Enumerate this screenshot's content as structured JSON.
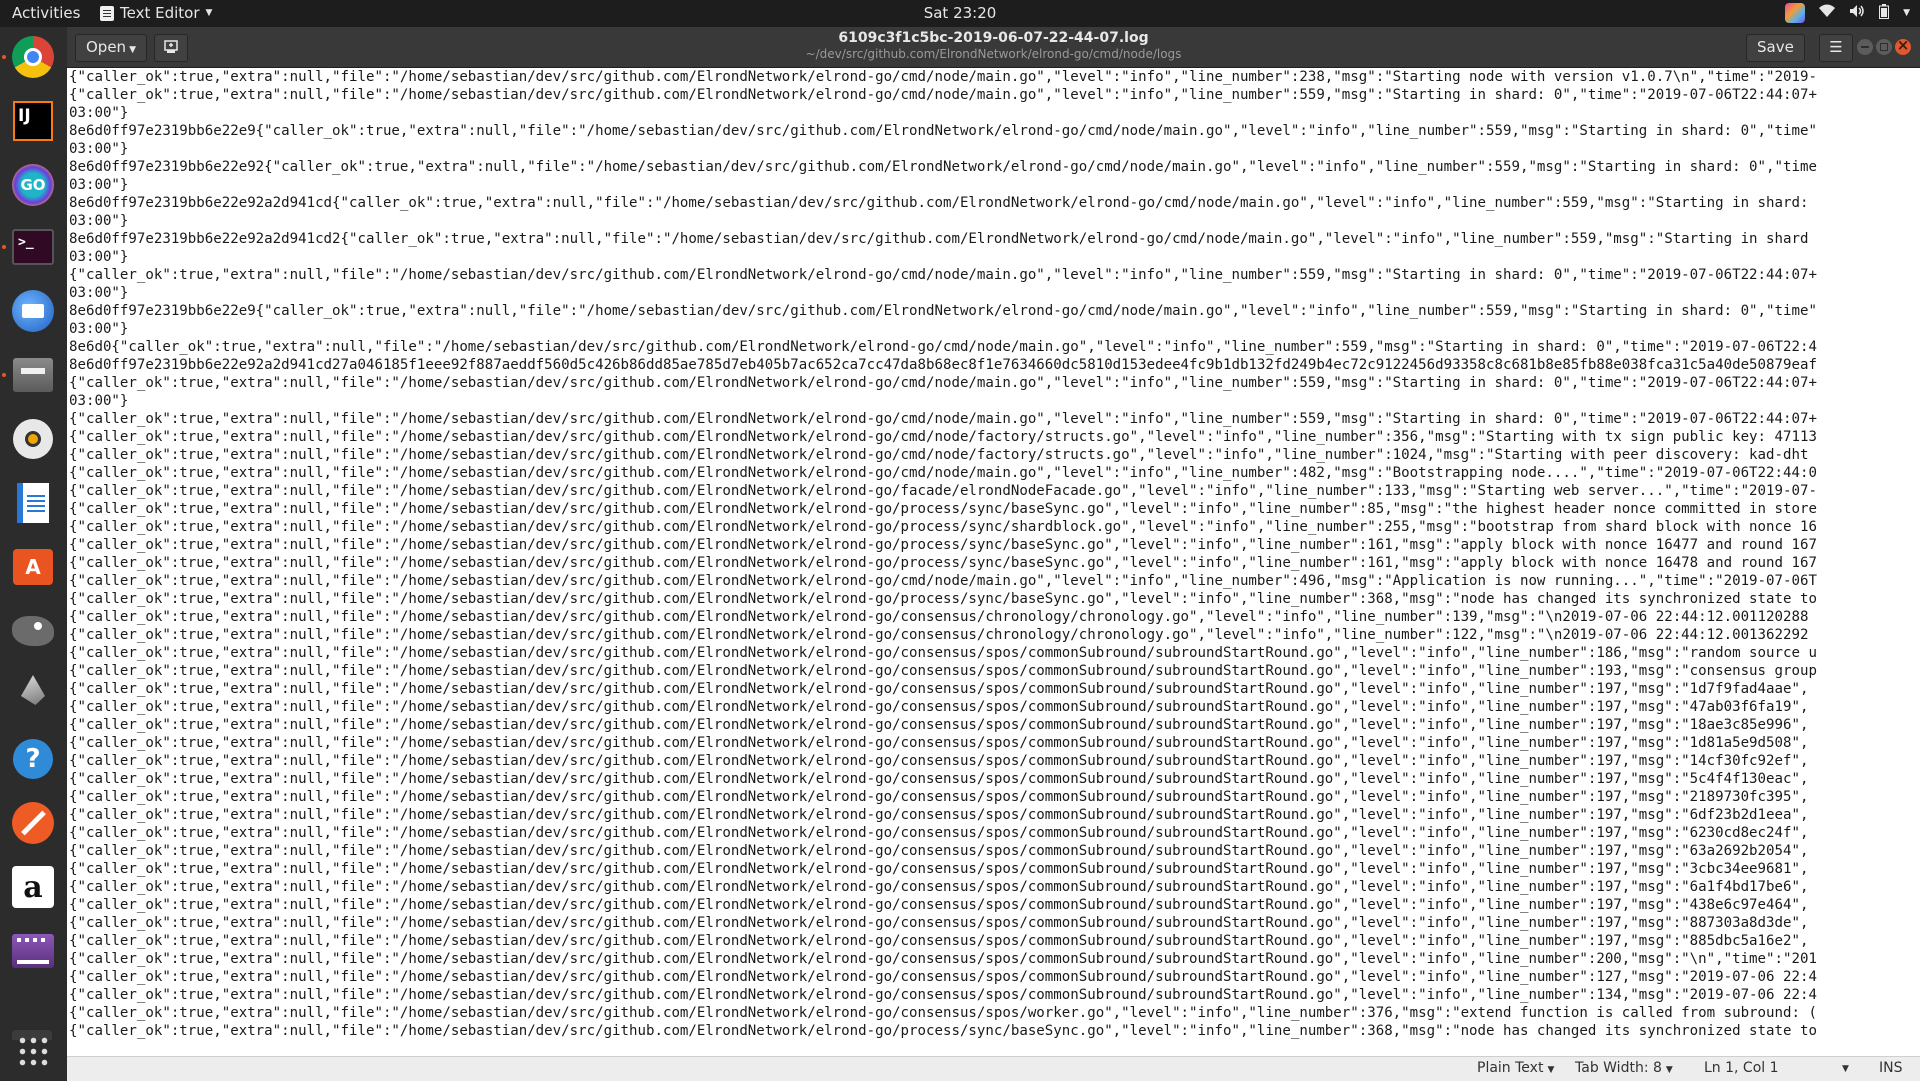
{
  "topbar": {
    "activities": "Activities",
    "app_name": "Text Editor",
    "clock": "Sat 23:20"
  },
  "dock": {
    "items": [
      "Chrome",
      "IntelliJ IDEA",
      "GoLand",
      "Terminal",
      "Thunderbird",
      "Files",
      "Rhythmbox",
      "LibreOffice Writer",
      "Ubuntu Software",
      "GIMP",
      "Inkscape",
      "Help",
      "Postman",
      "Amazon",
      "Videos",
      "Show Applications"
    ]
  },
  "header": {
    "open_label": "Open",
    "title": "6109c3f1c5bc-2019-06-07-22-44-07.log",
    "path": "~/dev/src/github.com/ElrondNetwork/elrond-go/cmd/node/logs",
    "save_label": "Save"
  },
  "editor": {
    "lines": [
      "{\"caller_ok\":true,\"extra\":null,\"file\":\"/home/sebastian/dev/src/github.com/ElrondNetwork/elrond-go/cmd/node/main.go\",\"level\":\"info\",\"line_number\":238,\"msg\":\"Starting node with version v1.0.7\\n\",\"time\":\"2019-",
      "{\"caller_ok\":true,\"extra\":null,\"file\":\"/home/sebastian/dev/src/github.com/ElrondNetwork/elrond-go/cmd/node/main.go\",\"level\":\"info\",\"line_number\":559,\"msg\":\"Starting in shard: 0\",\"time\":\"2019-07-06T22:44:07+",
      "03:00\"}",
      "8e6d0ff97e2319bb6e22e9{\"caller_ok\":true,\"extra\":null,\"file\":\"/home/sebastian/dev/src/github.com/ElrondNetwork/elrond-go/cmd/node/main.go\",\"level\":\"info\",\"line_number\":559,\"msg\":\"Starting in shard: 0\",\"time\"",
      "03:00\"}",
      "8e6d0ff97e2319bb6e22e92{\"caller_ok\":true,\"extra\":null,\"file\":\"/home/sebastian/dev/src/github.com/ElrondNetwork/elrond-go/cmd/node/main.go\",\"level\":\"info\",\"line_number\":559,\"msg\":\"Starting in shard: 0\",\"time",
      "03:00\"}",
      "8e6d0ff97e2319bb6e22e92a2d941cd{\"caller_ok\":true,\"extra\":null,\"file\":\"/home/sebastian/dev/src/github.com/ElrondNetwork/elrond-go/cmd/node/main.go\",\"level\":\"info\",\"line_number\":559,\"msg\":\"Starting in shard:",
      "03:00\"}",
      "8e6d0ff97e2319bb6e22e92a2d941cd2{\"caller_ok\":true,\"extra\":null,\"file\":\"/home/sebastian/dev/src/github.com/ElrondNetwork/elrond-go/cmd/node/main.go\",\"level\":\"info\",\"line_number\":559,\"msg\":\"Starting in shard",
      "03:00\"}",
      "{\"caller_ok\":true,\"extra\":null,\"file\":\"/home/sebastian/dev/src/github.com/ElrondNetwork/elrond-go/cmd/node/main.go\",\"level\":\"info\",\"line_number\":559,\"msg\":\"Starting in shard: 0\",\"time\":\"2019-07-06T22:44:07+",
      "03:00\"}",
      "8e6d0ff97e2319bb6e22e9{\"caller_ok\":true,\"extra\":null,\"file\":\"/home/sebastian/dev/src/github.com/ElrondNetwork/elrond-go/cmd/node/main.go\",\"level\":\"info\",\"line_number\":559,\"msg\":\"Starting in shard: 0\",\"time\"",
      "03:00\"}",
      "8e6d0{\"caller_ok\":true,\"extra\":null,\"file\":\"/home/sebastian/dev/src/github.com/ElrondNetwork/elrond-go/cmd/node/main.go\",\"level\":\"info\",\"line_number\":559,\"msg\":\"Starting in shard: 0\",\"time\":\"2019-07-06T22:4",
      "8e6d0ff97e2319bb6e22e92a2d941cd27a046185f1eee92f887aeddf560d5c426b86dd85ae785d7eb405b7ac652ca7cc47da8b68ec8f1e7634660dc5810d153edee4fc9b1db132fd249b4ec72c9122456d93358c8c681b8e85fb88e038fca31c5a40de50879eaf",
      "{\"caller_ok\":true,\"extra\":null,\"file\":\"/home/sebastian/dev/src/github.com/ElrondNetwork/elrond-go/cmd/node/main.go\",\"level\":\"info\",\"line_number\":559,\"msg\":\"Starting in shard: 0\",\"time\":\"2019-07-06T22:44:07+",
      "03:00\"}",
      "{\"caller_ok\":true,\"extra\":null,\"file\":\"/home/sebastian/dev/src/github.com/ElrondNetwork/elrond-go/cmd/node/main.go\",\"level\":\"info\",\"line_number\":559,\"msg\":\"Starting in shard: 0\",\"time\":\"2019-07-06T22:44:07+",
      "{\"caller_ok\":true,\"extra\":null,\"file\":\"/home/sebastian/dev/src/github.com/ElrondNetwork/elrond-go/cmd/node/factory/structs.go\",\"level\":\"info\",\"line_number\":356,\"msg\":\"Starting with tx sign public key: 47113",
      "{\"caller_ok\":true,\"extra\":null,\"file\":\"/home/sebastian/dev/src/github.com/ElrondNetwork/elrond-go/cmd/node/factory/structs.go\",\"level\":\"info\",\"line_number\":1024,\"msg\":\"Starting with peer discovery: kad-dht",
      "{\"caller_ok\":true,\"extra\":null,\"file\":\"/home/sebastian/dev/src/github.com/ElrondNetwork/elrond-go/cmd/node/main.go\",\"level\":\"info\",\"line_number\":482,\"msg\":\"Bootstrapping node....\",\"time\":\"2019-07-06T22:44:0",
      "{\"caller_ok\":true,\"extra\":null,\"file\":\"/home/sebastian/dev/src/github.com/ElrondNetwork/elrond-go/facade/elrondNodeFacade.go\",\"level\":\"info\",\"line_number\":133,\"msg\":\"Starting web server...\",\"time\":\"2019-07-",
      "{\"caller_ok\":true,\"extra\":null,\"file\":\"/home/sebastian/dev/src/github.com/ElrondNetwork/elrond-go/process/sync/baseSync.go\",\"level\":\"info\",\"line_number\":85,\"msg\":\"the highest header nonce committed in store",
      "{\"caller_ok\":true,\"extra\":null,\"file\":\"/home/sebastian/dev/src/github.com/ElrondNetwork/elrond-go/process/sync/shardblock.go\",\"level\":\"info\",\"line_number\":255,\"msg\":\"bootstrap from shard block with nonce 16",
      "{\"caller_ok\":true,\"extra\":null,\"file\":\"/home/sebastian/dev/src/github.com/ElrondNetwork/elrond-go/process/sync/baseSync.go\",\"level\":\"info\",\"line_number\":161,\"msg\":\"apply block with nonce 16477 and round 167",
      "{\"caller_ok\":true,\"extra\":null,\"file\":\"/home/sebastian/dev/src/github.com/ElrondNetwork/elrond-go/process/sync/baseSync.go\",\"level\":\"info\",\"line_number\":161,\"msg\":\"apply block with nonce 16478 and round 167",
      "{\"caller_ok\":true,\"extra\":null,\"file\":\"/home/sebastian/dev/src/github.com/ElrondNetwork/elrond-go/cmd/node/main.go\",\"level\":\"info\",\"line_number\":496,\"msg\":\"Application is now running...\",\"time\":\"2019-07-06T",
      "{\"caller_ok\":true,\"extra\":null,\"file\":\"/home/sebastian/dev/src/github.com/ElrondNetwork/elrond-go/process/sync/baseSync.go\",\"level\":\"info\",\"line_number\":368,\"msg\":\"node has changed its synchronized state to",
      "{\"caller_ok\":true,\"extra\":null,\"file\":\"/home/sebastian/dev/src/github.com/ElrondNetwork/elrond-go/consensus/chronology/chronology.go\",\"level\":\"info\",\"line_number\":139,\"msg\":\"\\n2019-07-06 22:44:12.001120288 ",
      "{\"caller_ok\":true,\"extra\":null,\"file\":\"/home/sebastian/dev/src/github.com/ElrondNetwork/elrond-go/consensus/chronology/chronology.go\",\"level\":\"info\",\"line_number\":122,\"msg\":\"\\n2019-07-06 22:44:12.001362292 ",
      "{\"caller_ok\":true,\"extra\":null,\"file\":\"/home/sebastian/dev/src/github.com/ElrondNetwork/elrond-go/consensus/spos/commonSubround/subroundStartRound.go\",\"level\":\"info\",\"line_number\":186,\"msg\":\"random source u",
      "{\"caller_ok\":true,\"extra\":null,\"file\":\"/home/sebastian/dev/src/github.com/ElrondNetwork/elrond-go/consensus/spos/commonSubround/subroundStartRound.go\",\"level\":\"info\",\"line_number\":193,\"msg\":\"consensus group",
      "{\"caller_ok\":true,\"extra\":null,\"file\":\"/home/sebastian/dev/src/github.com/ElrondNetwork/elrond-go/consensus/spos/commonSubround/subroundStartRound.go\",\"level\":\"info\",\"line_number\":197,\"msg\":\"1d7f9fad4aae\",",
      "{\"caller_ok\":true,\"extra\":null,\"file\":\"/home/sebastian/dev/src/github.com/ElrondNetwork/elrond-go/consensus/spos/commonSubround/subroundStartRound.go\",\"level\":\"info\",\"line_number\":197,\"msg\":\"47ab03f6fa19\",",
      "{\"caller_ok\":true,\"extra\":null,\"file\":\"/home/sebastian/dev/src/github.com/ElrondNetwork/elrond-go/consensus/spos/commonSubround/subroundStartRound.go\",\"level\":\"info\",\"line_number\":197,\"msg\":\"18ae3c85e996\",",
      "{\"caller_ok\":true,\"extra\":null,\"file\":\"/home/sebastian/dev/src/github.com/ElrondNetwork/elrond-go/consensus/spos/commonSubround/subroundStartRound.go\",\"level\":\"info\",\"line_number\":197,\"msg\":\"1d81a5e9d508\",",
      "{\"caller_ok\":true,\"extra\":null,\"file\":\"/home/sebastian/dev/src/github.com/ElrondNetwork/elrond-go/consensus/spos/commonSubround/subroundStartRound.go\",\"level\":\"info\",\"line_number\":197,\"msg\":\"14cf30fc92ef\",",
      "{\"caller_ok\":true,\"extra\":null,\"file\":\"/home/sebastian/dev/src/github.com/ElrondNetwork/elrond-go/consensus/spos/commonSubround/subroundStartRound.go\",\"level\":\"info\",\"line_number\":197,\"msg\":\"5c4f4f130eac\",",
      "{\"caller_ok\":true,\"extra\":null,\"file\":\"/home/sebastian/dev/src/github.com/ElrondNetwork/elrond-go/consensus/spos/commonSubround/subroundStartRound.go\",\"level\":\"info\",\"line_number\":197,\"msg\":\"2189730fc395\",",
      "{\"caller_ok\":true,\"extra\":null,\"file\":\"/home/sebastian/dev/src/github.com/ElrondNetwork/elrond-go/consensus/spos/commonSubround/subroundStartRound.go\",\"level\":\"info\",\"line_number\":197,\"msg\":\"6df23b2d1eea\",",
      "{\"caller_ok\":true,\"extra\":null,\"file\":\"/home/sebastian/dev/src/github.com/ElrondNetwork/elrond-go/consensus/spos/commonSubround/subroundStartRound.go\",\"level\":\"info\",\"line_number\":197,\"msg\":\"6230cd8ec24f\",",
      "{\"caller_ok\":true,\"extra\":null,\"file\":\"/home/sebastian/dev/src/github.com/ElrondNetwork/elrond-go/consensus/spos/commonSubround/subroundStartRound.go\",\"level\":\"info\",\"line_number\":197,\"msg\":\"63a2692b2054\",",
      "{\"caller_ok\":true,\"extra\":null,\"file\":\"/home/sebastian/dev/src/github.com/ElrondNetwork/elrond-go/consensus/spos/commonSubround/subroundStartRound.go\",\"level\":\"info\",\"line_number\":197,\"msg\":\"3cbc34ee9681\",",
      "{\"caller_ok\":true,\"extra\":null,\"file\":\"/home/sebastian/dev/src/github.com/ElrondNetwork/elrond-go/consensus/spos/commonSubround/subroundStartRound.go\",\"level\":\"info\",\"line_number\":197,\"msg\":\"6a1f4bd17be6\",",
      "{\"caller_ok\":true,\"extra\":null,\"file\":\"/home/sebastian/dev/src/github.com/ElrondNetwork/elrond-go/consensus/spos/commonSubround/subroundStartRound.go\",\"level\":\"info\",\"line_number\":197,\"msg\":\"438e6c97e464\",",
      "{\"caller_ok\":true,\"extra\":null,\"file\":\"/home/sebastian/dev/src/github.com/ElrondNetwork/elrond-go/consensus/spos/commonSubround/subroundStartRound.go\",\"level\":\"info\",\"line_number\":197,\"msg\":\"887303a8d3de\",",
      "{\"caller_ok\":true,\"extra\":null,\"file\":\"/home/sebastian/dev/src/github.com/ElrondNetwork/elrond-go/consensus/spos/commonSubround/subroundStartRound.go\",\"level\":\"info\",\"line_number\":197,\"msg\":\"885dbc5a16e2\",",
      "{\"caller_ok\":true,\"extra\":null,\"file\":\"/home/sebastian/dev/src/github.com/ElrondNetwork/elrond-go/consensus/spos/commonSubround/subroundStartRound.go\",\"level\":\"info\",\"line_number\":200,\"msg\":\"\\n\",\"time\":\"201",
      "{\"caller_ok\":true,\"extra\":null,\"file\":\"/home/sebastian/dev/src/github.com/ElrondNetwork/elrond-go/consensus/spos/commonSubround/subroundStartRound.go\",\"level\":\"info\",\"line_number\":127,\"msg\":\"2019-07-06 22:4",
      "{\"caller_ok\":true,\"extra\":null,\"file\":\"/home/sebastian/dev/src/github.com/ElrondNetwork/elrond-go/consensus/spos/commonSubround/subroundStartRound.go\",\"level\":\"info\",\"line_number\":134,\"msg\":\"2019-07-06 22:4",
      "{\"caller_ok\":true,\"extra\":null,\"file\":\"/home/sebastian/dev/src/github.com/ElrondNetwork/elrond-go/consensus/spos/worker.go\",\"level\":\"info\",\"line_number\":376,\"msg\":\"extend function is called from subround: (",
      "{\"caller_ok\":true,\"extra\":null,\"file\":\"/home/sebastian/dev/src/github.com/ElrondNetwork/elrond-go/process/sync/baseSync.go\",\"level\":\"info\",\"line_number\":368,\"msg\":\"node has changed its synchronized state to"
    ]
  },
  "statusbar": {
    "language": "Plain Text",
    "tab_width": "Tab Width: 8",
    "position": "Ln 1, Col 1",
    "mode": "INS"
  }
}
